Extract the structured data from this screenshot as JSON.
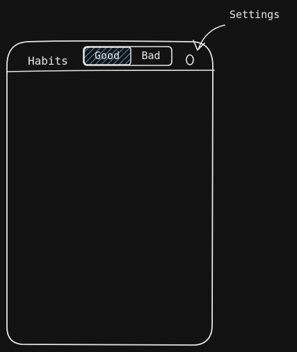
{
  "header": {
    "title": "Habits",
    "tabs": [
      {
        "label": "Good",
        "selected": true
      },
      {
        "label": "Bad",
        "selected": false
      }
    ],
    "settings_icon": "circle-icon"
  },
  "annotation": {
    "label": "Settings",
    "points_to": "settings-button"
  },
  "colors": {
    "background": "#121212",
    "ink": "#e6e6e6",
    "selected_hatch": "#4a8ab8"
  }
}
